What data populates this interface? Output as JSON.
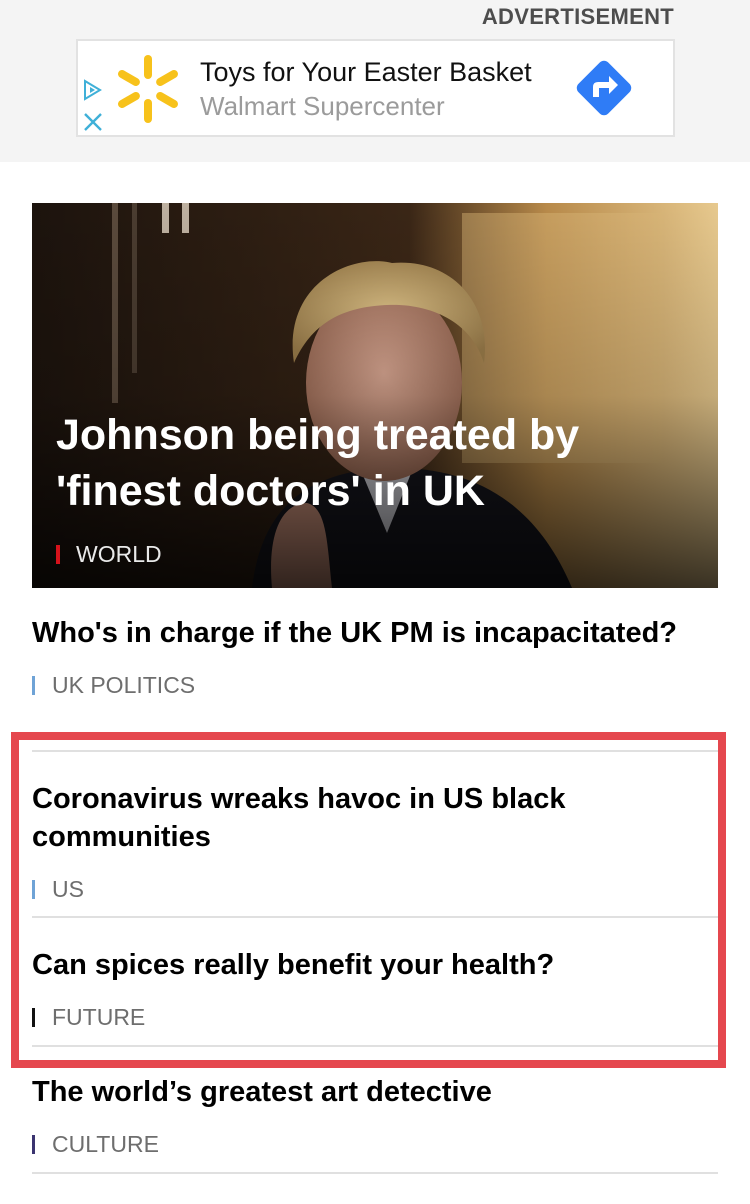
{
  "ad": {
    "label": "ADVERTISEMENT",
    "title": "Toys for Your Easter Basket",
    "subtitle": "Walmart Supercenter",
    "colors": {
      "spark": "#f7c21b",
      "directions": "#2f7cf6",
      "adchoice": "#3fb0d8"
    }
  },
  "hero": {
    "title": "Johnson being treated by 'finest doctors' in UK",
    "tag": "WORLD",
    "tag_color": "#d6121b"
  },
  "articles": [
    {
      "title": "Who's in charge if the UK PM is incapacitated?",
      "tag": "UK POLITICS",
      "tag_color": "#6fa3d6"
    },
    {
      "title": "Coronavirus wreaks havoc in US black communities",
      "tag": "US",
      "tag_color": "#6fa3d6"
    },
    {
      "title": "Can spices really benefit your health?",
      "tag": "FUTURE",
      "tag_color": "#111111"
    },
    {
      "title": "The world’s greatest art detective",
      "tag": "CULTURE",
      "tag_color": "#3b3470"
    }
  ],
  "highlight_color": "#e5474e"
}
